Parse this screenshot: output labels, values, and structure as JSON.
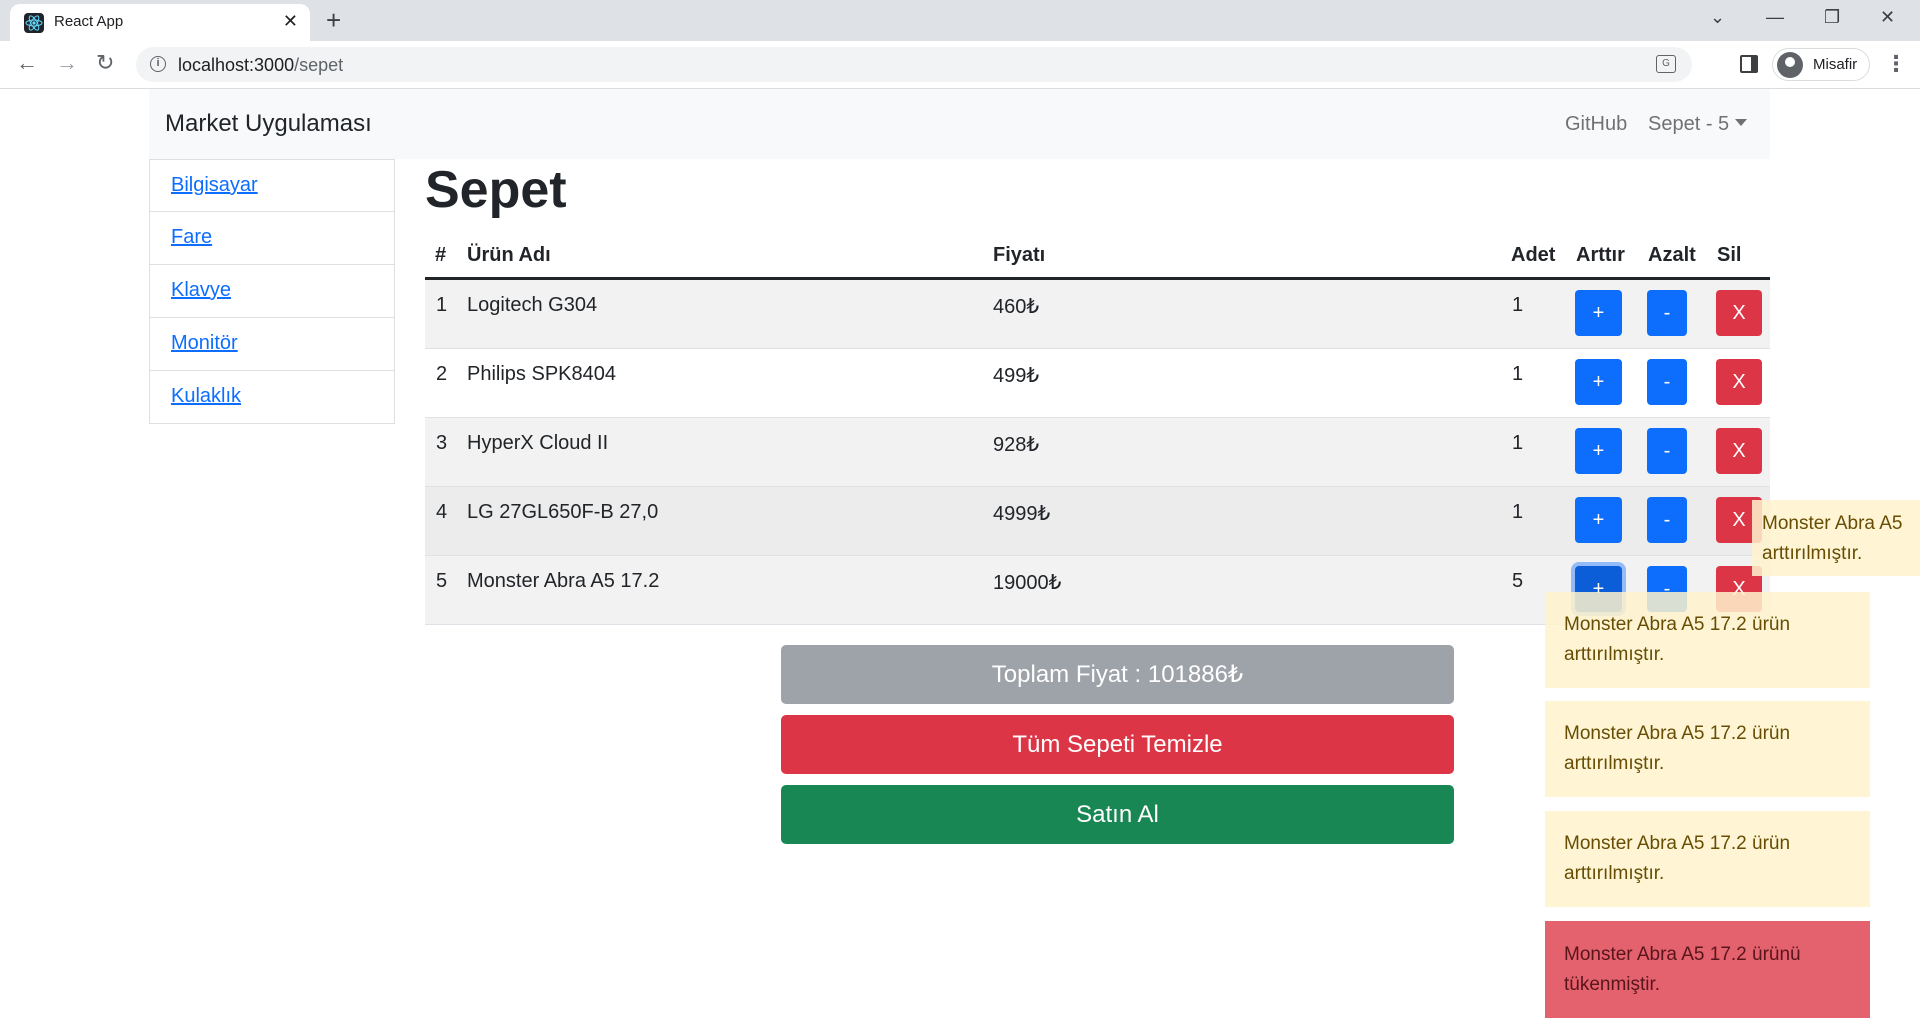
{
  "browser": {
    "tab_title": "React App",
    "url_host": "localhost:3000",
    "url_path": "/sepet",
    "profile_name": "Misafir"
  },
  "navbar": {
    "brand": "Market Uygulaması",
    "github": "GitHub",
    "cart": "Sepet - 5"
  },
  "categories": [
    "Bilgisayar",
    "Fare",
    "Klavye",
    "Monitör",
    "Kulaklık"
  ],
  "page": {
    "title": "Sepet"
  },
  "table": {
    "headers": {
      "num": "#",
      "name": "Ürün Adı",
      "price": "Fiyatı",
      "qty": "Adet",
      "inc": "Arttır",
      "dec": "Azalt",
      "del": "Sil"
    },
    "rows": [
      {
        "num": "1",
        "name": "Logitech G304",
        "price": "460₺",
        "qty": "1"
      },
      {
        "num": "2",
        "name": "Philips SPK8404",
        "price": "499₺",
        "qty": "1"
      },
      {
        "num": "3",
        "name": "HyperX Cloud II",
        "price": "928₺",
        "qty": "1"
      },
      {
        "num": "4",
        "name": "LG 27GL650F-B 27,0",
        "price": "4999₺",
        "qty": "1"
      },
      {
        "num": "5",
        "name": "Monster Abra A5 17.2",
        "price": "19000₺",
        "qty": "5"
      }
    ],
    "inc_label": "+",
    "dec_label": "-",
    "del_label": "X"
  },
  "summary": {
    "total": "Toplam Fiyat : 101886₺",
    "clear": "Tüm Sepeti Temizle",
    "buy": "Satın Al"
  },
  "toasts": [
    {
      "line1": "Monster Abra A5",
      "line2": "arttırılmıştır."
    },
    {
      "line1": "Monster Abra A5 17.2 ürün",
      "line2": "arttırılmıştır."
    },
    {
      "line1": "Monster Abra A5 17.2 ürün",
      "line2": "arttırılmıştır."
    },
    {
      "line1": "Monster Abra A5 17.2 ürün",
      "line2": "arttırılmıştır."
    },
    {
      "line1": "Monster Abra A5 17.2 ürünü",
      "line2": "tükenmiştir."
    }
  ]
}
